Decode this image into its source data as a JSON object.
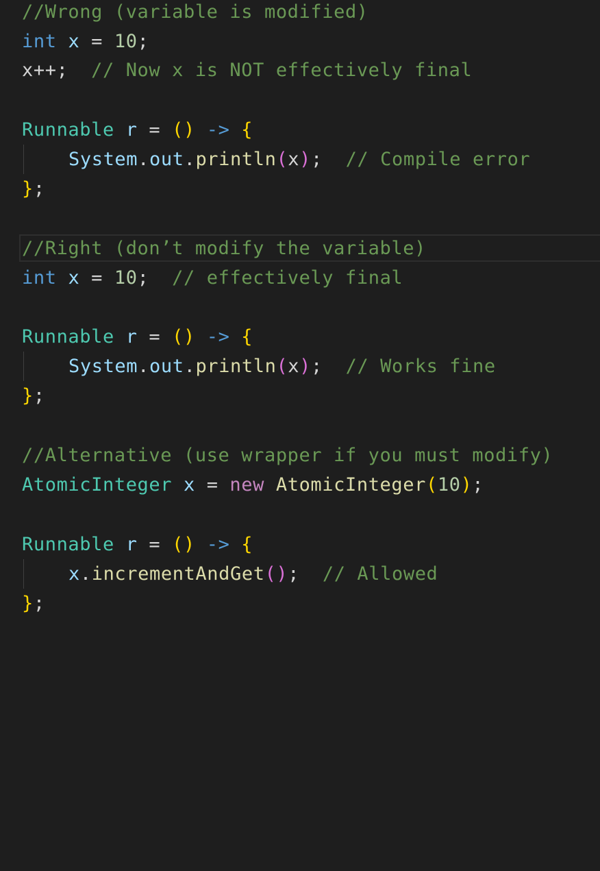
{
  "editor": {
    "colors": {
      "background": "#1e1e1e",
      "comment": "#6a9955",
      "type": "#4ec9b0",
      "keyword": "#569cd6",
      "control_keyword": "#c586c0",
      "variable": "#9cdcfe",
      "number": "#b5cea8",
      "function": "#dcdcaa",
      "bracket_level1": "#ffd700",
      "bracket_level2": "#da70d6"
    },
    "wrong": {
      "comment": "//Wrong (variable is modified)",
      "decl": {
        "type": "int",
        "var": "x",
        "eq": "=",
        "value": "10",
        "semi": ";"
      },
      "increment": {
        "stmt": "x++;",
        "comment": "// Now x is NOT effectively final"
      },
      "runnable": {
        "type": "Runnable",
        "var": "r",
        "eq": "=",
        "parens": "()",
        "arrow": "->",
        "open": "{"
      },
      "body": {
        "obj": "System",
        "dot1": ".",
        "field": "out",
        "dot2": ".",
        "method": "println",
        "lparen": "(",
        "arg": "x",
        "rparen": ")",
        "semi": ";",
        "comment": "// Compile error"
      },
      "close": {
        "brace": "}",
        "semi": ";"
      }
    },
    "right": {
      "comment": "//Right (don’t modify the variable)",
      "decl": {
        "type": "int",
        "var": "x",
        "eq": "=",
        "value": "10",
        "semi": ";",
        "comment": "// effectively final"
      },
      "runnable": {
        "type": "Runnable",
        "var": "r",
        "eq": "=",
        "parens": "()",
        "arrow": "->",
        "open": "{"
      },
      "body": {
        "obj": "System",
        "dot1": ".",
        "field": "out",
        "dot2": ".",
        "method": "println",
        "lparen": "(",
        "arg": "x",
        "rparen": ")",
        "semi": ";",
        "comment": "// Works fine"
      },
      "close": {
        "brace": "}",
        "semi": ";"
      }
    },
    "alternative": {
      "comment": "//Alternative (use wrapper if you must modify)",
      "decl": {
        "type": "AtomicInteger",
        "var": "x",
        "eq": "=",
        "kw_new": "new",
        "ctor": "AtomicInteger",
        "lparen": "(",
        "value": "10",
        "rparen": ")",
        "semi": ";"
      },
      "runnable": {
        "type": "Runnable",
        "var": "r",
        "eq": "=",
        "parens": "()",
        "arrow": "->",
        "open": "{"
      },
      "body": {
        "obj": "x",
        "dot": ".",
        "method": "incrementAndGet",
        "parens": "()",
        "semi": ";",
        "comment": "// Allowed"
      },
      "close": {
        "brace": "}",
        "semi": ";"
      }
    }
  }
}
